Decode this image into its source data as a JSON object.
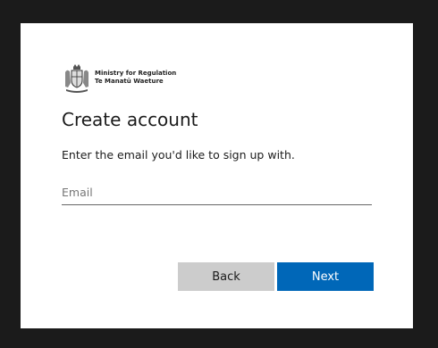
{
  "header": {
    "org_name_line1": "Ministry for Regulation",
    "org_name_line2": "Te Manatū Waeture",
    "crest_icon": "nz-coat-of-arms-icon"
  },
  "main": {
    "title": "Create account",
    "instruction": "Enter the email you'd like to sign up with.",
    "email": {
      "value": "",
      "placeholder": "Email"
    }
  },
  "actions": {
    "back_label": "Back",
    "next_label": "Next"
  },
  "colors": {
    "background": "#1b1b1b",
    "card": "#ffffff",
    "back_button": "#cccccc",
    "next_button": "#0067b8",
    "input_border": "#666666"
  }
}
